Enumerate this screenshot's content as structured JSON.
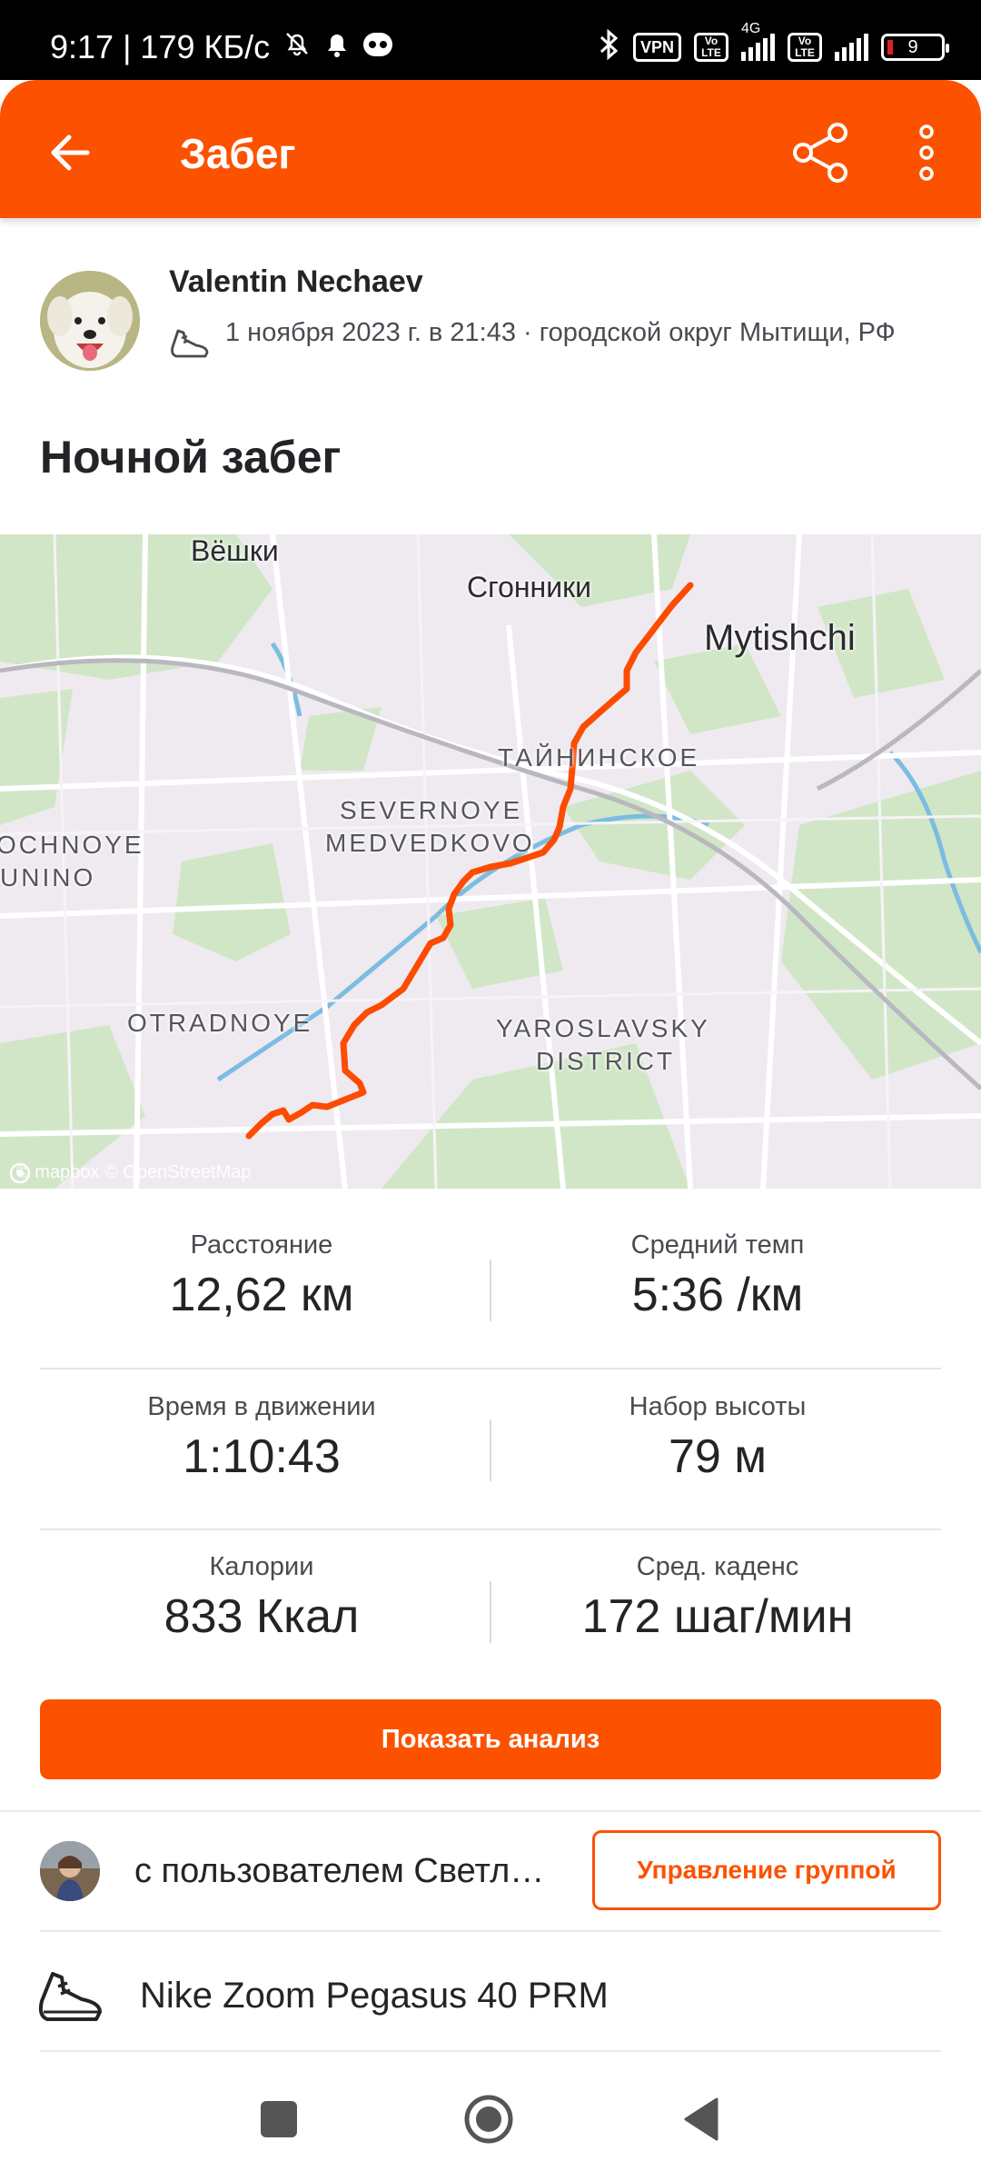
{
  "status_bar": {
    "time_speed": "9:17 | 179 КБ/с",
    "vpn": "VPN",
    "volte": "Vo LTE",
    "network": "4G",
    "battery": "9"
  },
  "header": {
    "title": "Забег"
  },
  "athlete": {
    "name": "Valentin Nechaev",
    "meta": "1 ноября 2023 г. в 21:43 · городской округ Мытищи, РФ"
  },
  "activity_title": "Ночной забег",
  "map": {
    "labels": {
      "veshki": "Вёшки",
      "sgonniki": "Сгонники",
      "mytishchi": "Mytishchi",
      "tayninskoe": "ТАЙНИНСКОЕ",
      "severnoye_1": "SEVERNOYE",
      "severnoye_2": "MEDVEDKOVO",
      "losinoostrovsky_1": "OCHNOYE",
      "losinoostrovsky_2": "UNINO",
      "otradnoye": "OTRADNOYE",
      "yaroslavsky_1": "YAROSLAVSKY",
      "yaroslavsky_2": "DISTRICT"
    },
    "attribution": "© mapbox © OpenStreetMap",
    "route_color": "#fc4c02"
  },
  "stats": [
    {
      "label": "Расстояние",
      "value": "12,62 км"
    },
    {
      "label": "Средний темп",
      "value": "5:36 /км"
    },
    {
      "label": "Время в движении",
      "value": "1:10:43"
    },
    {
      "label": "Набор высоты",
      "value": "79 м"
    },
    {
      "label": "Калории",
      "value": "833 Ккал"
    },
    {
      "label": "Сред. каденс",
      "value": "172 шаг/мин"
    }
  ],
  "analysis_button": "Показать анализ",
  "group": {
    "text": "с пользователем Светланой",
    "button": "Управление группой"
  },
  "gear": {
    "name": "Nike Zoom Pegasus 40 PRM"
  },
  "colors": {
    "brand": "#fc5200",
    "text": "#242428"
  }
}
